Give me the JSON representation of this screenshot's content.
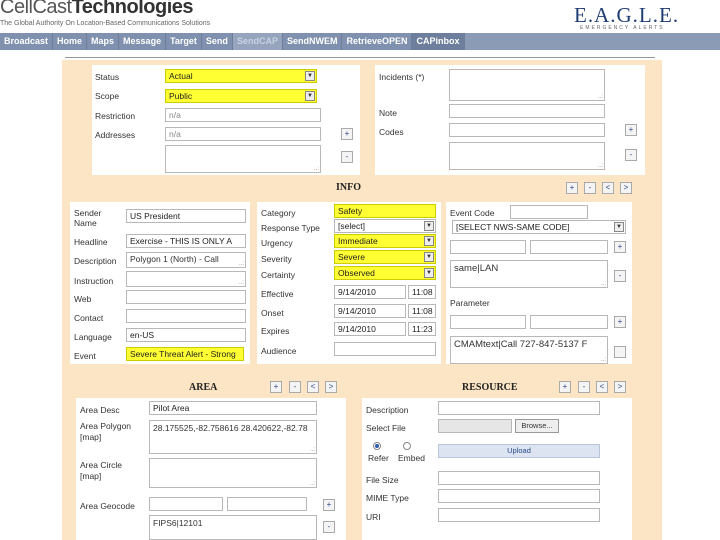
{
  "header": {
    "logo_light": "CellCast",
    "logo_bold": "Technologies",
    "tagline": "The Global Authority On Location-Based Communications Solutions",
    "eagle_logo": "E.A.G.L.E.",
    "eagle_sub": "EMERGENCY ALERTS"
  },
  "nav": {
    "tabs": [
      "Broadcast",
      "Home",
      "Maps",
      "Message",
      "Target",
      "Send",
      "SendCAP",
      "SendNWEM",
      "RetrieveOPEN",
      "CAPinbox"
    ]
  },
  "alert": {
    "status_label": "Status",
    "status_value": "Actual",
    "scope_label": "Scope",
    "scope_value": "Public",
    "restriction_label": "Restriction",
    "restriction_value": "n/a",
    "addresses_label": "Addresses",
    "addresses_value": "n/a",
    "incidents_label": "Incidents (*)",
    "note_label": "Note",
    "codes_label": "Codes"
  },
  "info": {
    "title": "INFO",
    "sender_name_label": "Sender Name",
    "sender_name_value": "US President",
    "headline_label": "Headline",
    "headline_value": "Exercise - THIS IS ONLY A",
    "description_label": "Description",
    "description_value": "Polygon 1 (North) - Call",
    "instruction_label": "Instruction",
    "web_label": "Web",
    "contact_label": "Contact",
    "language_label": "Language",
    "language_value": "en-US",
    "event_label": "Event",
    "event_value": "Severe Threat Alert - Strong",
    "category_label": "Category",
    "category_value": "Safety",
    "response_type_label": "Response Type",
    "response_type_value": "[select]",
    "urgency_label": "Urgency",
    "urgency_value": "Immediate",
    "severity_label": "Severity",
    "severity_value": "Severe",
    "certainty_label": "Certainty",
    "certainty_value": "Observed",
    "effective_label": "Effective",
    "effective_date": "9/14/2010",
    "effective_time": "11:08",
    "onset_label": "Onset",
    "onset_date": "9/14/2010",
    "onset_time": "11:08",
    "expires_label": "Expires",
    "expires_date": "9/14/2010",
    "expires_time": "11:23",
    "audience_label": "Audience",
    "event_code_label": "Event Code",
    "event_code_select": "[SELECT NWS-SAME CODE]",
    "event_code_value": "same|LAN",
    "parameter_label": "Parameter",
    "parameter_value": "CMAMtext|Call 727-847-5137 F"
  },
  "area": {
    "title": "AREA",
    "area_desc_label": "Area Desc",
    "area_desc_value": "Pilot Area",
    "area_polygon_label": "Area Polygon",
    "area_polygon_link": "[map]",
    "area_polygon_value": "28.175525,-82.758616 28.420622,-82.78",
    "area_circle_label": "Area Circle",
    "area_circle_link": "[map]",
    "area_geocode_label": "Area Geocode",
    "area_geocode_value": "FIPS6|12101"
  },
  "resource": {
    "title": "RESOURCE",
    "description_label": "Description",
    "select_file_label": "Select File",
    "browse_label": "Browse...",
    "refer_label": "Refer",
    "embed_label": "Embed",
    "upload_label": "Upload",
    "file_size_label": "File Size",
    "mime_type_label": "MIME Type",
    "uri_label": "URI"
  },
  "buttons": {
    "plus": "+",
    "minus": "-",
    "prev": "<",
    "next": ">"
  },
  "icons": {
    "dropdown": "dropdown-arrow-icon",
    "resize": "resize-grip-icon"
  },
  "colors": {
    "panel": "#fbe5c4",
    "highlight": "#ffff33",
    "nav": "#8b9bb5"
  }
}
